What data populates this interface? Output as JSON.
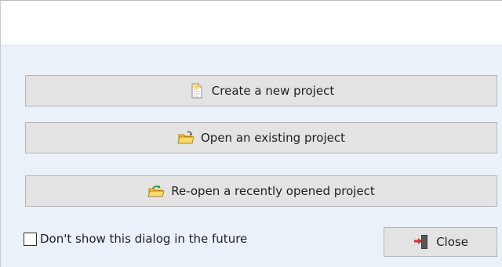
{
  "dialog": {
    "actions": {
      "create": {
        "label": "Create a new project",
        "icon": "new-document-sparkle-icon"
      },
      "open": {
        "label": "Open an existing project",
        "icon": "open-folder-icon"
      },
      "reopen": {
        "label": "Re-open a recently opened project",
        "icon": "recent-folder-icon"
      }
    },
    "footer": {
      "checkbox_label": "Don't show this dialog in the future",
      "checkbox_checked": false,
      "close_label": "Close",
      "close_icon": "exit-door-icon"
    }
  },
  "colors": {
    "panel_background": "#ebf1f9",
    "button_background": "#e3e3e3",
    "button_border": "#b5b5b5"
  }
}
